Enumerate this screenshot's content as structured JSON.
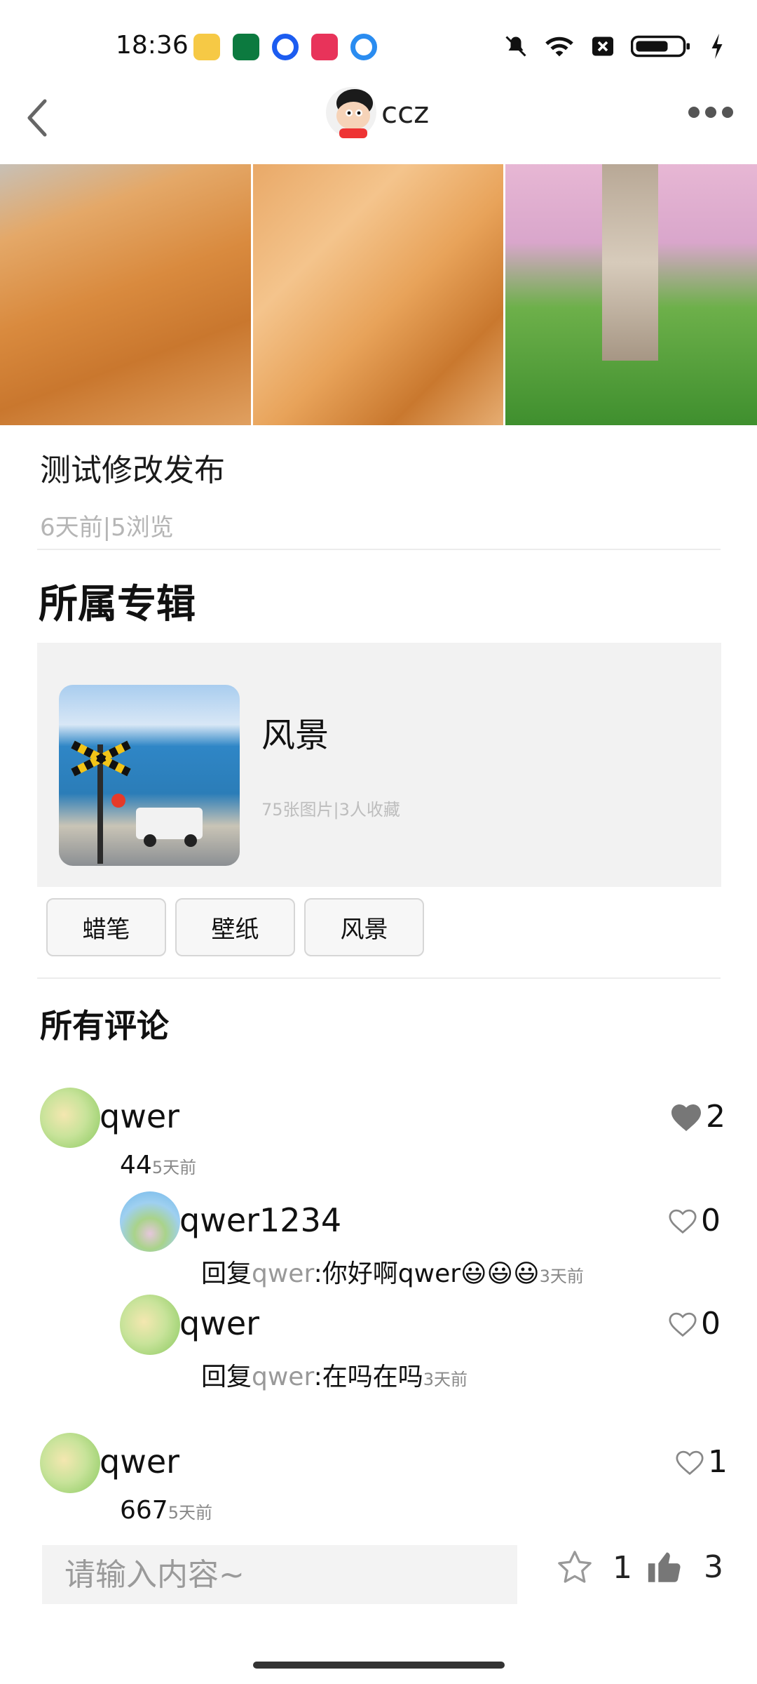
{
  "status_bar": {
    "time": "18:36"
  },
  "header": {
    "back_icon": "chevron-left-icon",
    "user_name": "ccz",
    "more_icon": "more-dots-icon"
  },
  "post": {
    "title": "测试修改发布",
    "meta": "6天前|5浏览"
  },
  "album_section": {
    "title": "所属专辑",
    "album": {
      "name": "风景",
      "stats": "75张图片|3人收藏"
    }
  },
  "tags": [
    "蜡笔",
    "壁纸",
    "风景"
  ],
  "comments_section": {
    "title": "所有评论",
    "comments": [
      {
        "user": "qwer",
        "text": "44",
        "time": "5天前",
        "likes": "2",
        "liked": true,
        "replies": [
          {
            "user": "qwer1234",
            "prefix": "回复",
            "target": "qwer",
            "text": ":你好啊qwer😃😃😃",
            "time": "3天前",
            "likes": "0"
          },
          {
            "user": "qwer",
            "prefix": "回复",
            "target": "qwer",
            "text": ":在吗在吗",
            "time": "3天前",
            "likes": "0"
          }
        ]
      },
      {
        "user": "qwer",
        "text": "667",
        "time": "5天前",
        "likes": "1",
        "liked": false
      }
    ]
  },
  "bottom_bar": {
    "input_placeholder": "请输入内容~",
    "favorite_count": "1",
    "thumb_count": "3"
  },
  "colors": {
    "card_bg": "#f2f2f2",
    "meta_gray": "#b5b5b5",
    "heart_filled": "#777777"
  }
}
